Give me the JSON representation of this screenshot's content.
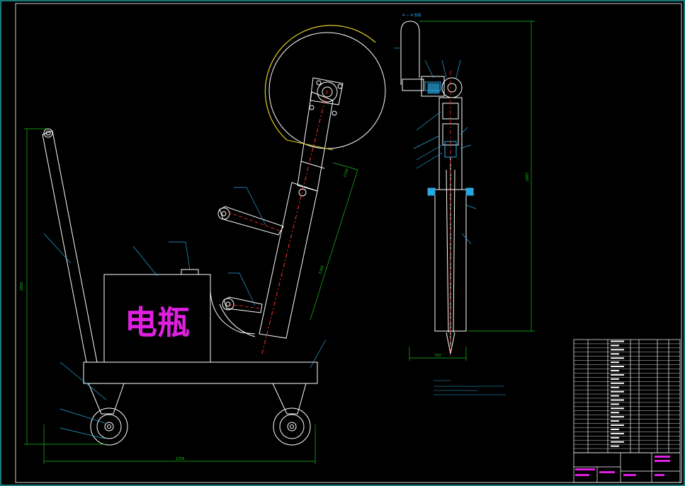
{
  "drawing": {
    "battery_label": "电瓶",
    "dim_overall_height": "1800",
    "dim_overall_width": "1256",
    "dim_boom_length": "2700",
    "dim_boom_lower": "3300",
    "dim_side_height": "2887",
    "dim_side_width": "702",
    "section_label": "A — A 剖视",
    "colors": {
      "outline": "#ffffff",
      "dimension": "#18c018",
      "centerline": "#ff3030",
      "blade": "#e0d020",
      "leader": "#2aa6e0",
      "battery_text": "#e020e0",
      "frame_border": "#28c8c8"
    }
  }
}
